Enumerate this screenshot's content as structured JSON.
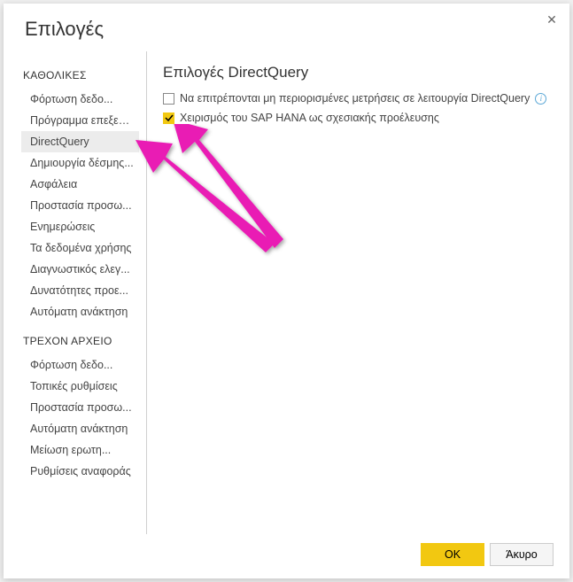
{
  "dialog": {
    "title": "Επιλογές"
  },
  "sidebar": {
    "section1_header": "ΚΑΘΟΛΙΚΕΣ",
    "section2_header": "ΤΡΕΧΟΝ ΑΡΧΕΙΟ",
    "global": {
      "item0": "Φόρτωση δεδο...",
      "item1": "Πρόγραμμα επεξερ...",
      "item2": "DirectQuery",
      "item3": "Δημιουργία δέσμης...",
      "item4": "Ασφάλεια",
      "item5": "Προστασία προσω...",
      "item6": "Ενημερώσεις",
      "item7": "Τα δεδομένα χρήσης",
      "item8": "Διαγνωστικός ελεγ...",
      "item9": "Δυνατότητες προε...",
      "item10": "Αυτόματη ανάκτηση"
    },
    "current": {
      "item0": "Φόρτωση δεδο...",
      "item1": "Τοπικές ρυθμίσεις",
      "item2": "Προστασία προσω...",
      "item3": "Αυτόματη ανάκτηση",
      "item4": "Μείωση ερωτη...",
      "item5": "Ρυθμίσεις αναφοράς"
    }
  },
  "main": {
    "heading": "Επιλογές DirectQuery",
    "option1_label": "Να επιτρέπονται μη περιορισμένες μετρήσεις σε λειτουργία DirectQuery",
    "option1_checked": false,
    "option2_label": "Χειρισμός του SAP HANA ως σχεσιακής προέλευσης",
    "option2_checked": true
  },
  "buttons": {
    "ok": "OK",
    "cancel": "Άκυρο"
  }
}
